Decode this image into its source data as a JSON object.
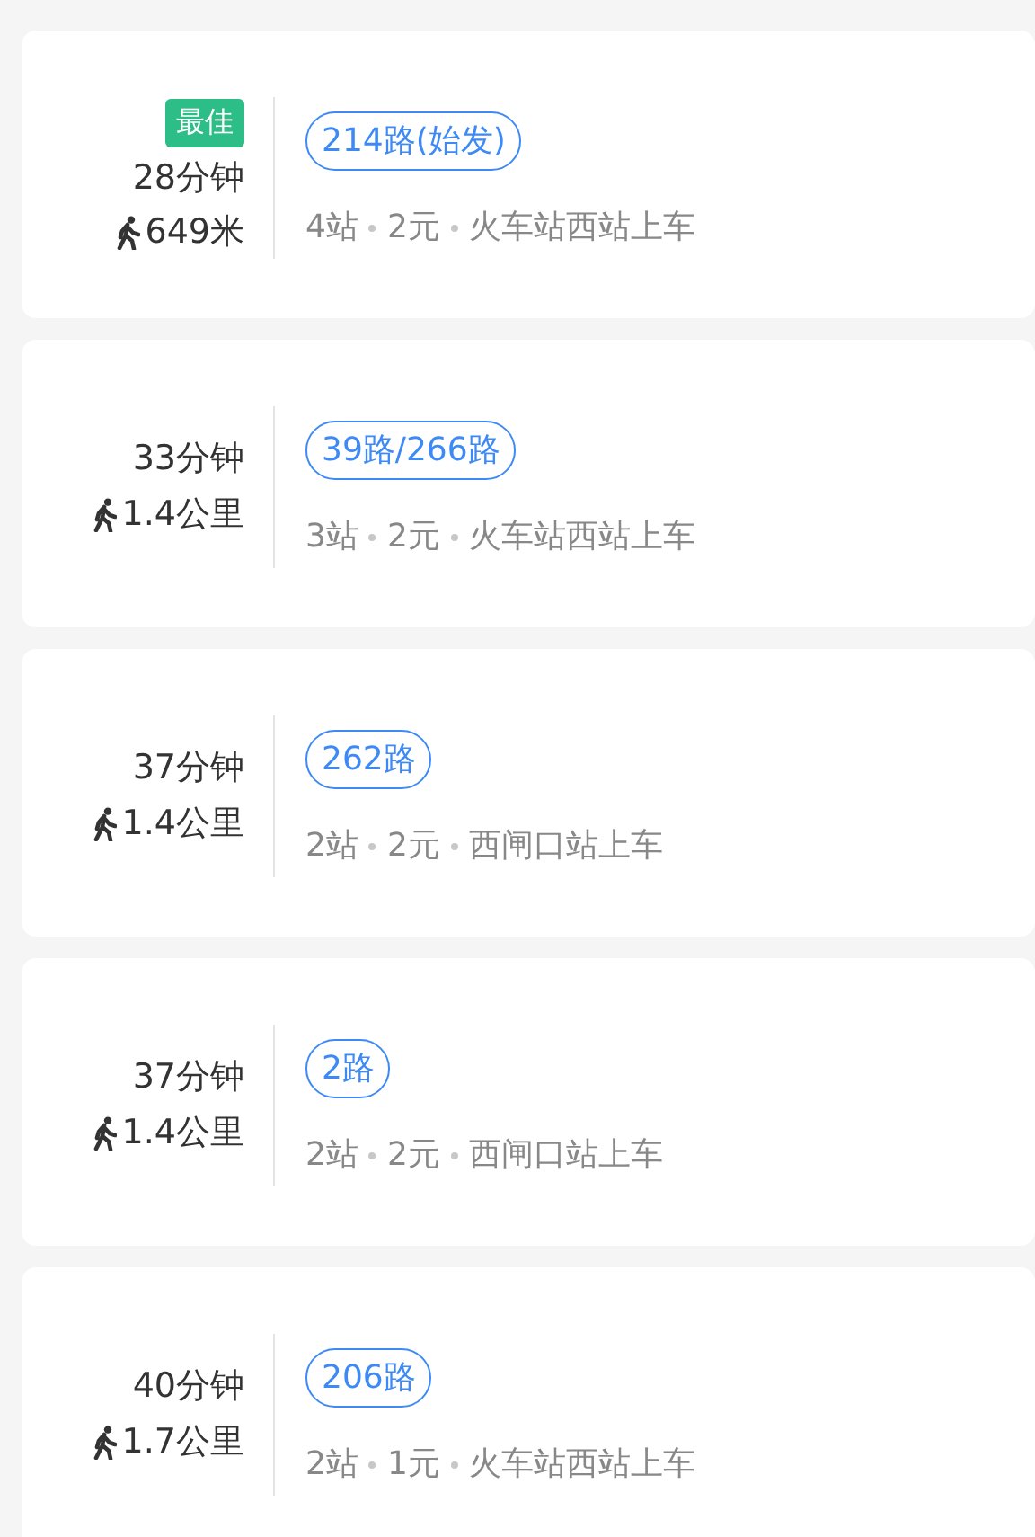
{
  "routes": [
    {
      "badge": "最佳",
      "duration": "28分钟",
      "walk": "649米",
      "route": "214路(始发)",
      "details": [
        "4站",
        "2元",
        "火车站西站上车"
      ]
    },
    {
      "duration": "33分钟",
      "walk": "1.4公里",
      "route": "39路/266路",
      "details": [
        "3站",
        "2元",
        "火车站西站上车"
      ]
    },
    {
      "duration": "37分钟",
      "walk": "1.4公里",
      "route": "262路",
      "details": [
        "2站",
        "2元",
        "西闸口站上车"
      ]
    },
    {
      "duration": "37分钟",
      "walk": "1.4公里",
      "route": "2路",
      "details": [
        "2站",
        "2元",
        "西闸口站上车"
      ]
    },
    {
      "duration": "40分钟",
      "walk": "1.7公里",
      "route": "206路",
      "details": [
        "2站",
        "1元",
        "火车站西站上车"
      ]
    }
  ]
}
